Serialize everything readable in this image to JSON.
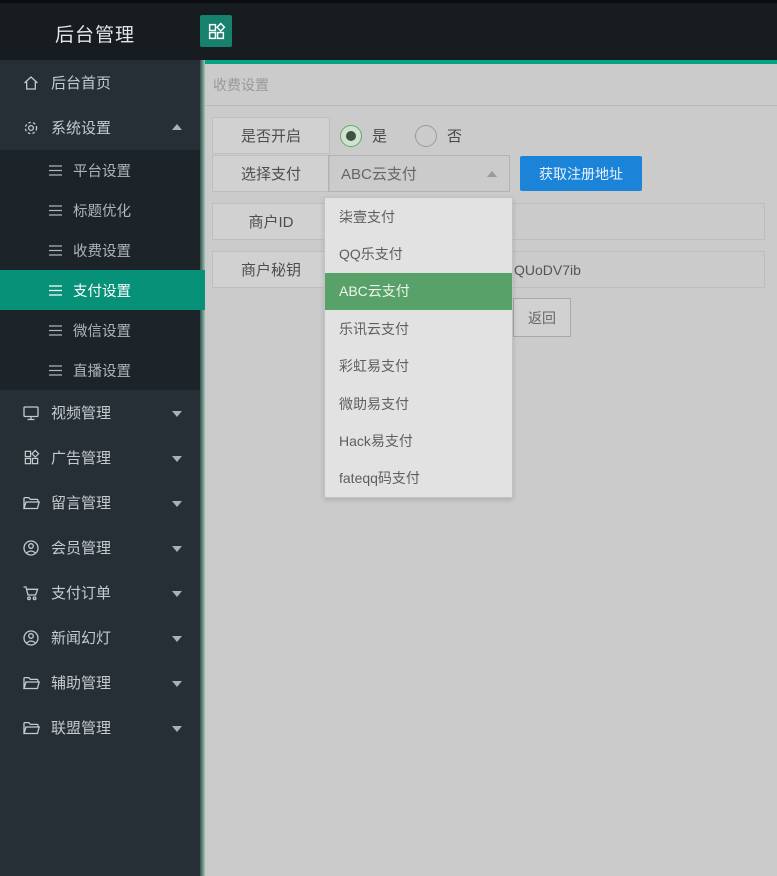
{
  "header": {
    "title": "后台管理",
    "apps_button_icon": "apps-grid-icon"
  },
  "sidebar": {
    "items": [
      {
        "label": "后台首页",
        "icon": "home-icon"
      },
      {
        "label": "系统设置",
        "icon": "gear-icon",
        "expanded": true,
        "children": [
          {
            "label": "平台设置"
          },
          {
            "label": "标题优化"
          },
          {
            "label": "收费设置"
          },
          {
            "label": "支付设置",
            "active": true
          },
          {
            "label": "微信设置"
          },
          {
            "label": "直播设置"
          }
        ]
      },
      {
        "label": "视频管理",
        "icon": "monitor-icon"
      },
      {
        "label": "广告管理",
        "icon": "apps-grid-icon"
      },
      {
        "label": "留言管理",
        "icon": "folder-icon"
      },
      {
        "label": "会员管理",
        "icon": "user-circle-icon"
      },
      {
        "label": "支付订单",
        "icon": "cart-icon"
      },
      {
        "label": "新闻幻灯",
        "icon": "user-circle-icon"
      },
      {
        "label": "辅助管理",
        "icon": "folder-icon"
      },
      {
        "label": "联盟管理",
        "icon": "folder-icon"
      }
    ]
  },
  "main": {
    "breadcrumb": "收费设置",
    "form": {
      "enable_label": "是否开启",
      "radio_yes": "是",
      "radio_no": "否",
      "enable_selected": "是",
      "pay_select_label": "选择支付",
      "pay_select_value": "ABC云支付",
      "register_button": "获取注册地址",
      "merchant_id_label": "商户ID",
      "merchant_id_value": "",
      "merchant_key_label": "商户秘钥",
      "merchant_key_visible": "QUoDV7ib",
      "back_button": "返回"
    },
    "dropdown": {
      "open": true,
      "options": [
        "柒壹支付",
        "QQ乐支付",
        "ABC云支付",
        "乐讯云支付",
        "彩虹易支付",
        "微助易支付",
        "Hack易支付",
        "fateqq码支付"
      ],
      "selected_index": 2,
      "selected_value": "ABC云支付"
    }
  },
  "colors": {
    "accent_teal": "#079178",
    "content_top_border": "#04a287",
    "header_icon_teal": "#17816e",
    "dropdown_selected_green": "#58a269",
    "primary_button_blue": "#1b84d9",
    "page_background": "#cbcbcb",
    "sidebar_background": "#272f36",
    "header_background": "#171c20"
  }
}
